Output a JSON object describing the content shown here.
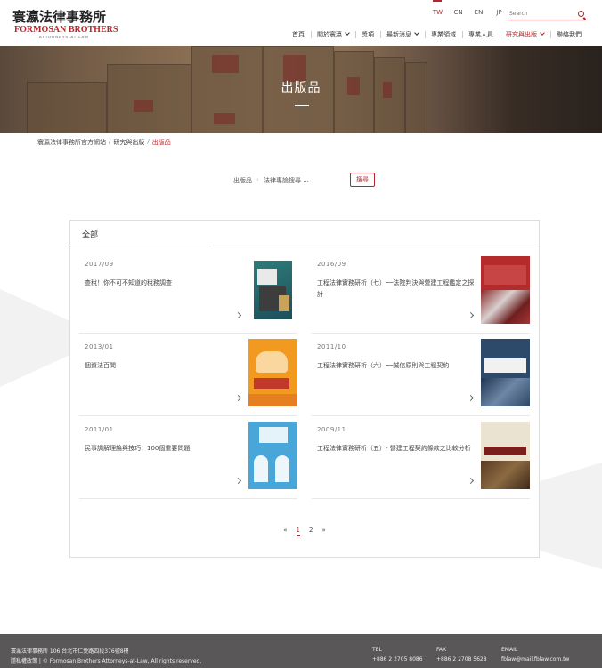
{
  "header": {
    "logo_cn": "寰瀛法律事務所",
    "logo_en": "FORMOSAN BROTHERS",
    "logo_sub": "ATTORNEYS-AT-LAW",
    "languages": [
      "TW",
      "CN",
      "EN",
      "JP"
    ],
    "active_language": "TW",
    "search_placeholder": "Search"
  },
  "nav": {
    "items": [
      {
        "label": "首頁"
      },
      {
        "label": "關於寰瀛"
      },
      {
        "label": "獎項"
      },
      {
        "label": "最新消息"
      },
      {
        "label": "專業領域"
      },
      {
        "label": "專業人員"
      },
      {
        "label": "研究與出版"
      },
      {
        "label": "聯絡我們"
      }
    ]
  },
  "banner": {
    "title": "出版品"
  },
  "breadcrumb": {
    "items": [
      "寰瀛法律事務所官方網站",
      "研究與出版",
      "出版品"
    ]
  },
  "filter": {
    "label": "出版品",
    "select_value": "法律專論搜尋 ...",
    "button": "搜尋"
  },
  "panel": {
    "tab": "全部",
    "cards": [
      {
        "date": "2017/09",
        "title": "查稅！你不可不知道的稅務調查"
      },
      {
        "date": "2016/09",
        "title": "工程法律實務研析（七）──法院判決與營建工程鑑定之探討"
      },
      {
        "date": "2013/01",
        "title": "個資法百問"
      },
      {
        "date": "2011/10",
        "title": "工程法律實務研析（六）──誠信原則與工程契約"
      },
      {
        "date": "2011/01",
        "title": "民事調解理論與技巧：100個重要問題"
      },
      {
        "date": "2009/11",
        "title": "工程法律實務研析（五）- 營建工程契約條款之比較分析"
      }
    ],
    "pagination": {
      "prev": "«",
      "pages": [
        "1",
        "2"
      ],
      "current": "1",
      "next": "»"
    }
  },
  "footer": {
    "address": "寰瀛法律事務所 106 台北市仁愛路四段376號8樓",
    "rights": "隱私權政策 | © Formosan Brothers Attorneys-at-Law, All rights reserved.",
    "tel_label": "TEL",
    "tel": "+886 2 2705 8086",
    "fax_label": "FAX",
    "fax": "+886 2 2708 5628",
    "email_label": "EMAIL",
    "email": "fblaw@mail.fblaw.com.tw"
  },
  "colors": {
    "accent": "#b4262b",
    "footer_bg": "#595757"
  }
}
